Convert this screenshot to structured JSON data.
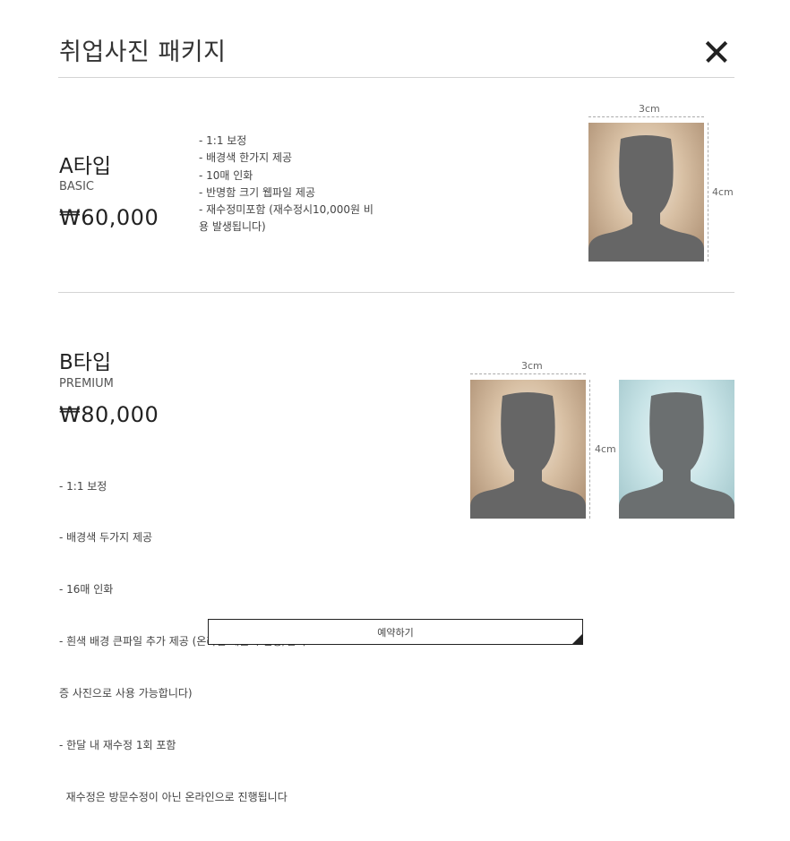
{
  "modal": {
    "title": "취업사진 패키지",
    "close_icon": "close-icon"
  },
  "packages": [
    {
      "name": "A타입",
      "tier": "BASIC",
      "price": "₩60,000",
      "features": [
        "- 1:1 보정",
        "- 배경색 한가지 제공",
        "- 10매 인화",
        "- 반명함 크기 웹파일 제공",
        "- 재수정미포함 (재수정시10,000원 비",
        "용 발생됩니다)"
      ],
      "width_label": "3cm",
      "height_label": "4cm",
      "photo_backgrounds": [
        "beige"
      ]
    },
    {
      "name": "B타입",
      "tier": "PREMIUM",
      "price": "₩80,000",
      "features": [
        "- 1:1 보정",
        "- 배경색 두가지 제공",
        "- 16매 인화",
        "- 흰색 배경 큰파일 추가 제공 (온라인 제출시 민증/면허",
        "증 사진으로 사용 가능합니다)",
        "- 한달 내 재수정 1회 포함",
        "  재수정은 방문수정이 아닌 온라인으로 진행됩니다"
      ],
      "width_label": "3cm",
      "height_label": "4cm",
      "photo_backgrounds": [
        "beige",
        "light-blue"
      ]
    }
  ],
  "reserve_button": {
    "label": "예약하기"
  },
  "colors": {
    "text": "#333333",
    "divider": "#d4d4d4",
    "photo_beige": "#d8c0a4",
    "photo_blue": "#c7e3e6",
    "silhouette": "#666666"
  }
}
